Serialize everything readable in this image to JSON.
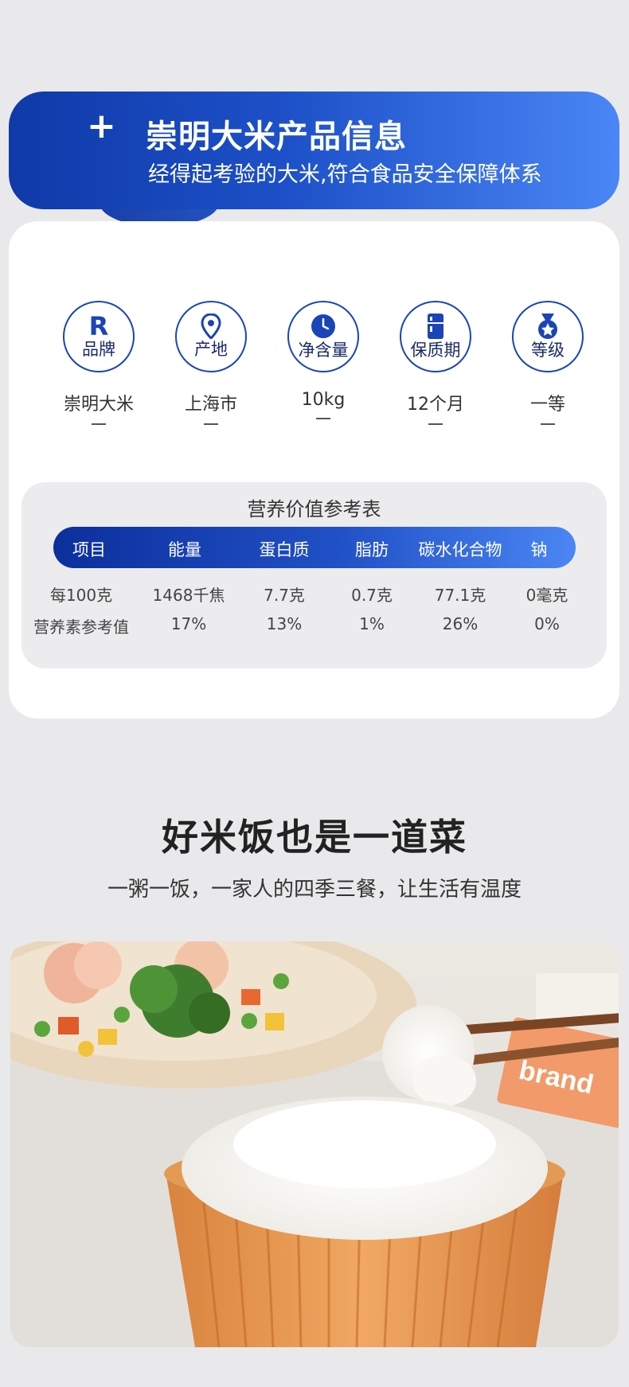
{
  "banner": {
    "plus": "+",
    "title": "崇明大米产品信息",
    "subtitle": "经得起考验的大米,符合食品安全保障体系"
  },
  "specs": [
    {
      "icon": "r-letter-icon",
      "icon_text": "R",
      "label": "品牌",
      "value": "崇明大米"
    },
    {
      "icon": "location-pin-icon",
      "label": "产地",
      "value": "上海市"
    },
    {
      "icon": "clock-icon",
      "label": "净含量",
      "value": "10kg"
    },
    {
      "icon": "calendar-icon",
      "label": "保质期",
      "value": "12个月"
    },
    {
      "icon": "medal-icon",
      "label": "等级",
      "value": "一等"
    }
  ],
  "nutrition": {
    "title": "营养价值参考表",
    "headers": [
      "项目",
      "能量",
      "蛋白质",
      "脂肪",
      "碳水化合物",
      "钠"
    ],
    "rows": [
      [
        "每100克",
        "1468千焦",
        "7.7克",
        "0.7克",
        "77.1克",
        "0毫克"
      ],
      [
        "营养素参考值",
        "17%",
        "13%",
        "1%",
        "26%",
        "0%"
      ]
    ]
  },
  "section": {
    "headline": "好米饭也是一道菜",
    "subline": "一粥一饭，一家人的四季三餐，让生活有温度"
  },
  "photo": {
    "label": "brand"
  },
  "colors": {
    "accent_dark": "#0f3aa8",
    "accent_light": "#4a86f5",
    "background": "#e9e9eb"
  }
}
